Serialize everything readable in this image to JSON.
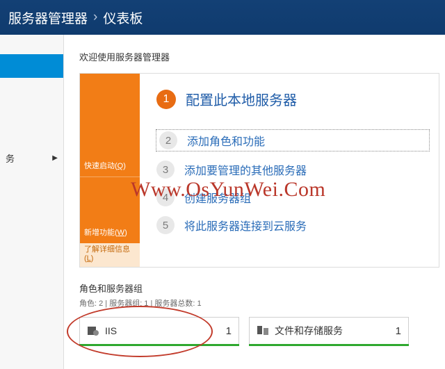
{
  "header": {
    "app_title": "服务器管理器",
    "separator": "•",
    "page": "仪表板"
  },
  "sidebar": {
    "items": [
      {
        "label": "务"
      }
    ]
  },
  "welcome": {
    "title": "欢迎使用服务器管理器",
    "quick_start": "快速启动(Q)",
    "whats_new": "新增功能(W)",
    "learn_more": "了解详细信息(L)",
    "steps": [
      {
        "n": "1",
        "label": "配置此本地服务器"
      },
      {
        "n": "2",
        "label": "添加角色和功能"
      },
      {
        "n": "3",
        "label": "添加要管理的其他服务器"
      },
      {
        "n": "4",
        "label": "创建服务器组"
      },
      {
        "n": "5",
        "label": "将此服务器连接到云服务"
      }
    ]
  },
  "groups": {
    "title": "角色和服务器组",
    "subtitle": "角色: 2 | 服务器组: 1 | 服务器总数: 1",
    "tiles": [
      {
        "name": "IIS",
        "count": "1"
      },
      {
        "name": "文件和存储服务",
        "count": "1"
      }
    ]
  },
  "watermark": "Www.OsYunWei.Com"
}
